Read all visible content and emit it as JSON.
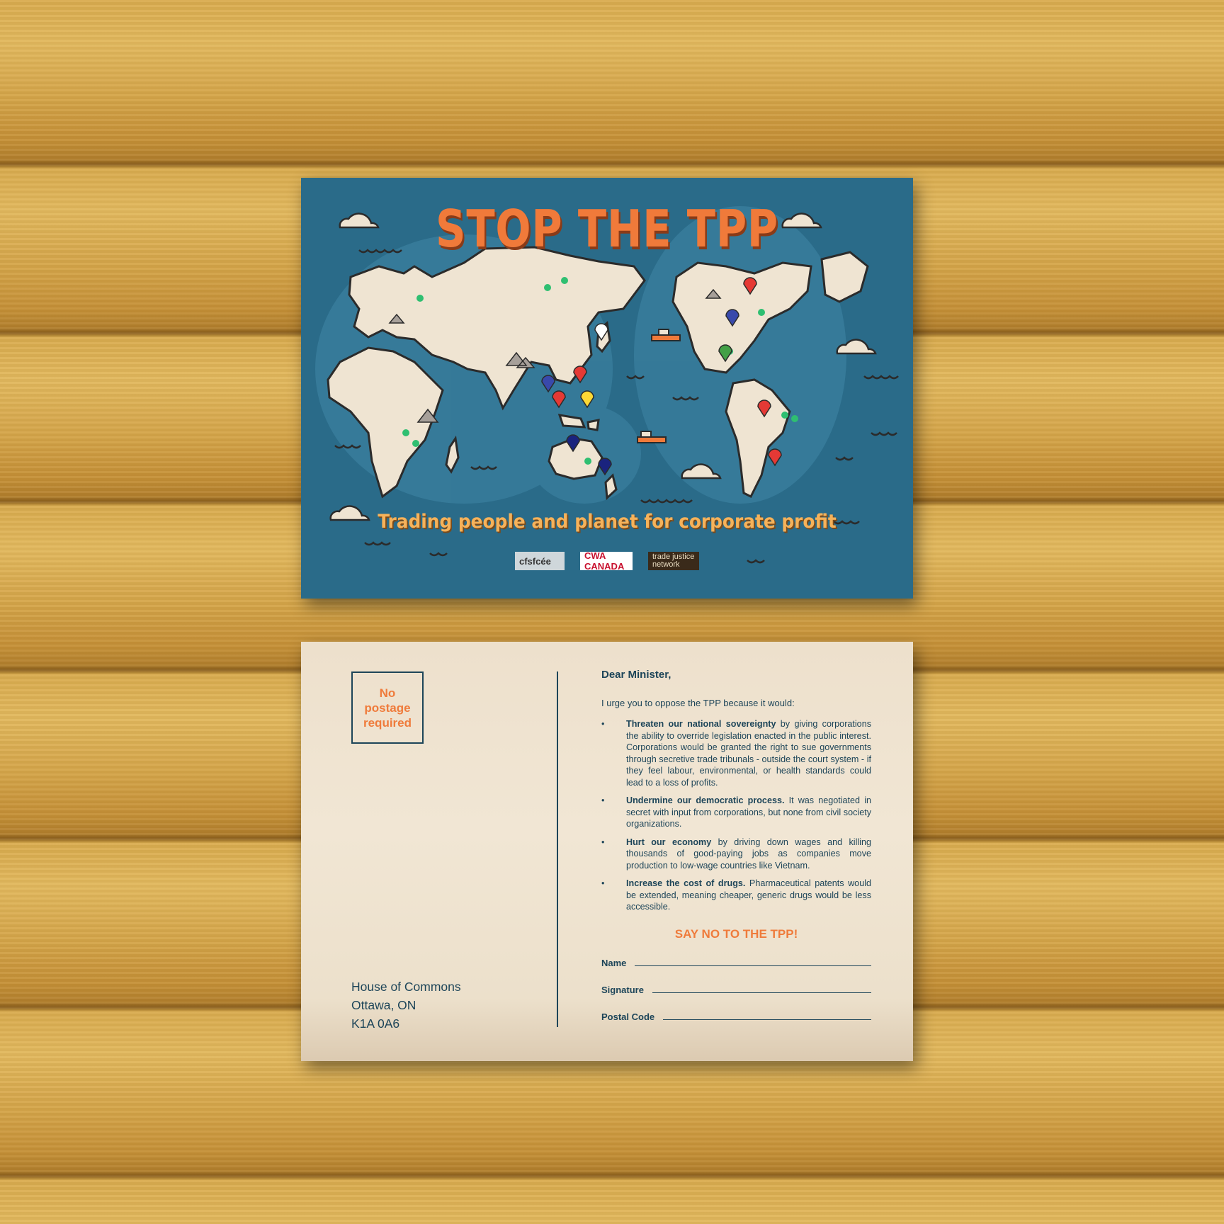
{
  "front": {
    "title": "STOP THE TPP",
    "subtitle": "Trading people and planet for corporate profit",
    "logos": [
      {
        "text": "cfsfcée"
      },
      {
        "text": "CWA CANADA"
      },
      {
        "text": "trade justice network"
      }
    ]
  },
  "back": {
    "stamp": "No postage required",
    "address": [
      "House of Commons",
      "Ottawa, ON",
      "K1A 0A6"
    ],
    "greeting": "Dear Minister,",
    "intro": "I urge you to oppose the TPP because it would:",
    "points": [
      {
        "bold": "Threaten our national sovereignty",
        "text": " by giving corporations the ability to override legislation enacted in the public interest. Corporations would be granted the right to sue governments through secretive trade tribunals - outside the court system - if they feel labour, environmental, or health standards could lead to a loss of profits."
      },
      {
        "bold": "Undermine our democratic process.",
        "text": " It was negotiated in secret with input from corporations, but none from civil society organizations."
      },
      {
        "bold": "Hurt our economy",
        "text": " by driving down wages and killing thousands of good-paying jobs as companies move production to low-wage countries like Vietnam."
      },
      {
        "bold": "Increase the cost of drugs.",
        "text": " Pharmaceutical patents would be extended, meaning cheaper, generic drugs would be less accessible."
      }
    ],
    "bullet": "•",
    "cta": "SAY NO TO THE TPP!",
    "fields": [
      "Name",
      "Signature",
      "Postal Code"
    ]
  },
  "colors": {
    "ocean": "#2a6b89",
    "land": "#efe4d2",
    "accent": "#f07a3a",
    "ink": "#1d4559"
  }
}
